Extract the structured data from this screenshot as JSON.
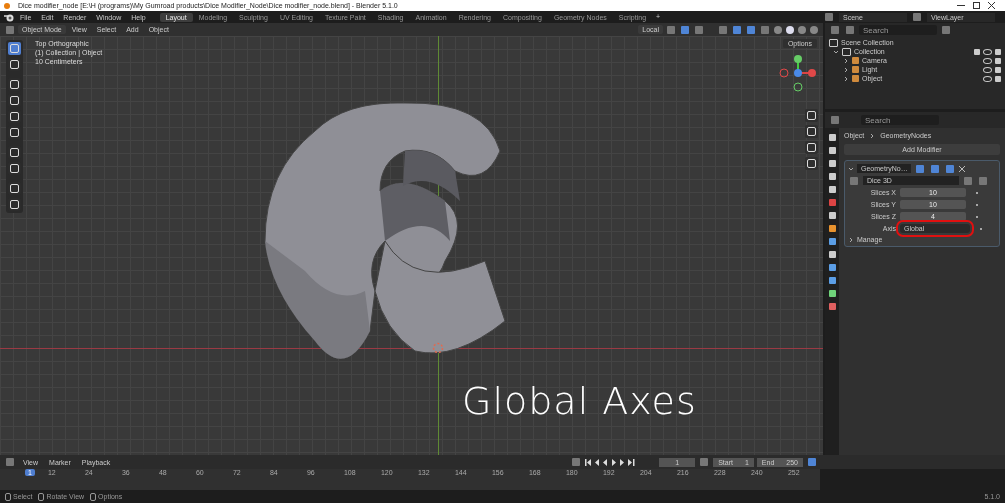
{
  "window": {
    "title": "Dice modifier_node [E:\\H (programs)\\My Gumroad products\\Dice Modifier_Node\\Dice modifier_node.blend] - Blender 5.1.0"
  },
  "menu": [
    "File",
    "Edit",
    "Render",
    "Window",
    "Help"
  ],
  "workspaces": [
    {
      "label": "Layout",
      "selected": true
    },
    {
      "label": "Modeling",
      "selected": false
    },
    {
      "label": "Sculpting",
      "selected": false
    },
    {
      "label": "UV Editing",
      "selected": false
    },
    {
      "label": "Texture Paint",
      "selected": false
    },
    {
      "label": "Shading",
      "selected": false
    },
    {
      "label": "Animation",
      "selected": false
    },
    {
      "label": "Rendering",
      "selected": false
    },
    {
      "label": "Compositing",
      "selected": false
    },
    {
      "label": "Geometry Nodes",
      "selected": false
    },
    {
      "label": "Scripting",
      "selected": false
    }
  ],
  "add_workspace": "+",
  "scene": "Scene",
  "view_layer": "ViewLayer",
  "viewport_header": {
    "mode": "Object Mode",
    "menus": [
      "View",
      "Select",
      "Add",
      "Object"
    ],
    "orientation": "Local",
    "options": "Options"
  },
  "viewport": {
    "overlay_lines": [
      "Top Orthographic",
      "(1) Collection | Object",
      "10 Centimeters"
    ],
    "caption": "Global Axes"
  },
  "outliner": {
    "search_placeholder": "Search",
    "root": "Scene Collection",
    "items": [
      {
        "label": "Collection",
        "expanded": true,
        "children": [
          {
            "label": "Camera",
            "expanded": false
          },
          {
            "label": "Light",
            "expanded": false
          },
          {
            "label": "Object",
            "expanded": false
          }
        ]
      }
    ]
  },
  "properties": {
    "search_placeholder": "Search",
    "breadcrumb": [
      "Object",
      "GeometryNodes"
    ],
    "add_modifier": "Add Modifier",
    "modifier": {
      "name": "GeometryNo…",
      "expanded": true,
      "node_group": "Dice 3D",
      "inputs": [
        {
          "label": "Slices X",
          "value": "10",
          "kind": "number",
          "highlighted": false
        },
        {
          "label": "Slices Y",
          "value": "10",
          "kind": "number",
          "highlighted": false
        },
        {
          "label": "Slices Z",
          "value": "4",
          "kind": "number",
          "highlighted": false
        },
        {
          "label": "Axis",
          "value": "Global",
          "kind": "dropdown",
          "highlighted": true
        }
      ],
      "manage": "Manage"
    }
  },
  "timeline": {
    "menus": [
      "View",
      "Marker"
    ],
    "playback": "Playback",
    "current_frame": "1",
    "start_label": "Start",
    "start": "1",
    "end_label": "End",
    "end": "250",
    "marker": "1",
    "ticks": [
      "12",
      "24",
      "36",
      "48",
      "60",
      "72",
      "84",
      "96",
      "108",
      "120",
      "132",
      "144",
      "156",
      "168",
      "180",
      "192",
      "204",
      "216",
      "228",
      "240",
      "252"
    ]
  },
  "status_bar": {
    "hints": [
      "Select",
      "Rotate View",
      "Options"
    ],
    "version": "5.1.0"
  }
}
